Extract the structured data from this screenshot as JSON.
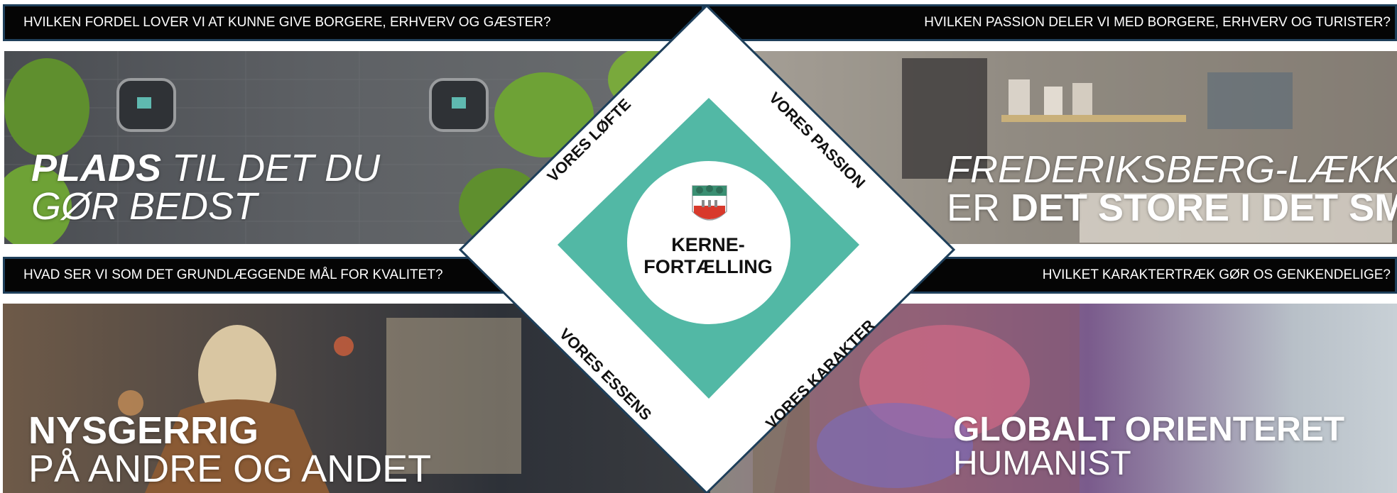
{
  "questions": {
    "top_left": "HVILKEN FORDEL LOVER VI AT KUNNE GIVE BORGERE, ERHVERV OG GÆSTER?",
    "top_right": "HVILKEN PASSION DELER VI MED BORGERE, ERHVERV OG TURISTER?",
    "bottom_left": "HVAD SER VI SOM DET GRUNDLÆGGENDE MÅL FOR KVALITET?",
    "bottom_right": "HVILKET KARAKTERTRÆK GØR OS GENKENDELIGE?"
  },
  "headlines": {
    "top_left": {
      "bold": "PLADS",
      "rest": " TIL DET DU",
      "line2": "GØR BEDST"
    },
    "top_right": {
      "line1": "FREDERIKSBERG-LÆKKERT",
      "prefix": "ER ",
      "bold": "DET STORE I DET SMÅ"
    },
    "bottom_left": {
      "bold": "NYSGERRIG",
      "line2": "PÅ ANDRE OG ANDET"
    },
    "bottom_right": {
      "bold": "GLOBALT ORIENTERET",
      "line2": "HUMANIST"
    }
  },
  "diamond": {
    "center_line1": "KERNE-",
    "center_line2": "FORTÆLLING",
    "label_loefte": "VORES LØFTE",
    "label_passion": "VORES PASSION",
    "label_essens": "VORES ESSENS",
    "label_karakter": "VORES KARAKTER"
  },
  "colors": {
    "teal": "#52b8a5",
    "bar_background": "#050505",
    "bar_border": "#1e3f5a",
    "diamond_outline": "#1e3f5a"
  },
  "icons": [
    "frederiksberg-coat-of-arms-icon"
  ]
}
